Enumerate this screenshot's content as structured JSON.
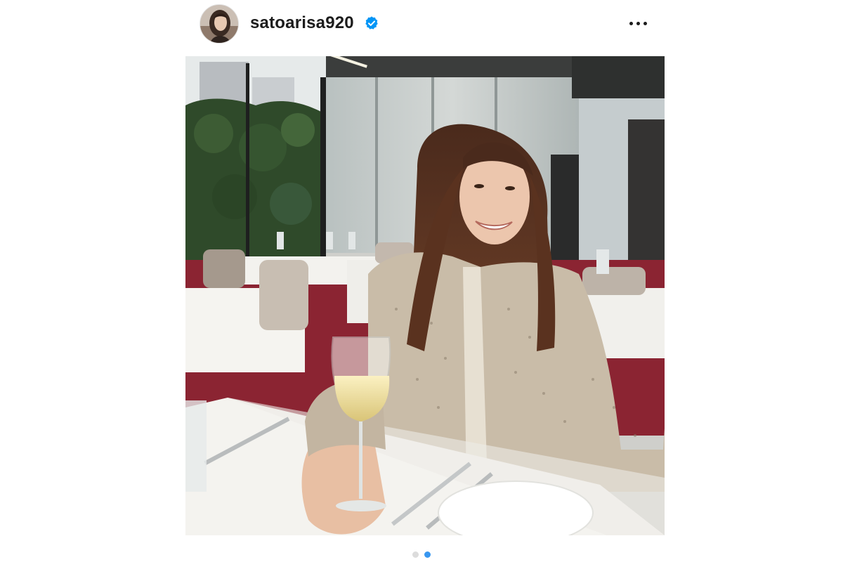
{
  "post": {
    "username": "satoarisa920",
    "verified": true,
    "more_icon": "more-horizontal-icon",
    "verified_icon": "verified-badge-icon"
  },
  "carousel": {
    "total": 2,
    "active_index": 1
  },
  "colors": {
    "verified_blue": "#0095f6",
    "active_dot": "#3897f0",
    "inactive_dot": "#dcdcdc",
    "text": "#1c1c1c"
  }
}
